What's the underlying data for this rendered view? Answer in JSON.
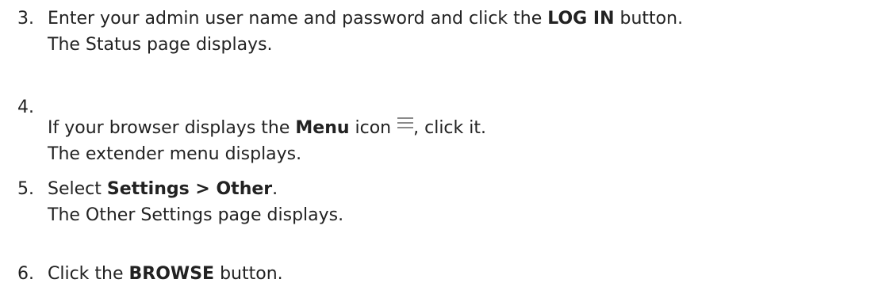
{
  "steps": [
    {
      "number": "3.",
      "pre": "Enter your admin user name and password and click the ",
      "bold": "LOG IN",
      "post": " button.",
      "result": "The Status page displays."
    },
    {
      "number": "4.",
      "pre": "If your browser displays the ",
      "bold": "Menu",
      "post_icon_text": " icon",
      "icon": "menu-icon",
      "post": ", click it.",
      "result": "The extender menu displays."
    },
    {
      "number": "5.",
      "pre": "Select ",
      "bold": "Settings > Other",
      "post": ".",
      "result": "The Other Settings page displays."
    },
    {
      "number": "6.",
      "pre": "Click the ",
      "bold": "BROWSE",
      "post": " button."
    }
  ],
  "colors": {
    "text": "#222222",
    "icon": "#8a8a8a"
  }
}
